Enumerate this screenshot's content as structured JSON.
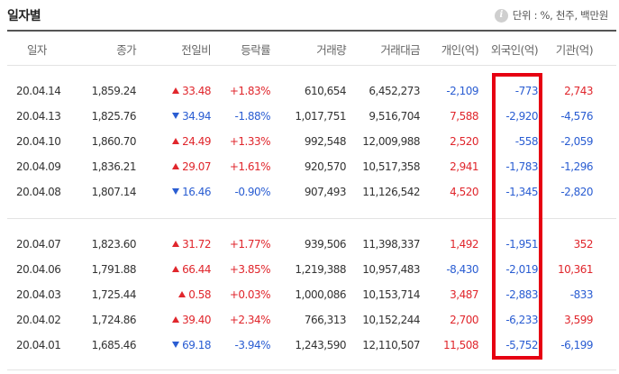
{
  "title": "일자별",
  "unit_text": "단위 : %, 천주, 백만원",
  "columns": [
    "일자",
    "종가",
    "전일비",
    "등락률",
    "거래량",
    "거래대금",
    "개인(억)",
    "외국인(억)",
    "기관(억)"
  ],
  "colors": {
    "up": "#e0262c",
    "down": "#2a5dd2",
    "highlight": "#e60012"
  },
  "rows": [
    {
      "date": "20.04.14",
      "close": "1,859.24",
      "change": "33.48",
      "change_dir": "up",
      "rate": "+1.83%",
      "volume": "610,654",
      "amount": "6,452,273",
      "individual": "-2,109",
      "foreign": "-773",
      "institution": "2,743"
    },
    {
      "date": "20.04.13",
      "close": "1,825.76",
      "change": "34.94",
      "change_dir": "down",
      "rate": "-1.88%",
      "volume": "1,017,751",
      "amount": "9,516,704",
      "individual": "7,588",
      "foreign": "-2,920",
      "institution": "-4,576"
    },
    {
      "date": "20.04.10",
      "close": "1,860.70",
      "change": "24.49",
      "change_dir": "up",
      "rate": "+1.33%",
      "volume": "992,548",
      "amount": "12,009,988",
      "individual": "2,520",
      "foreign": "-558",
      "institution": "-2,059"
    },
    {
      "date": "20.04.09",
      "close": "1,836.21",
      "change": "29.07",
      "change_dir": "up",
      "rate": "+1.61%",
      "volume": "920,570",
      "amount": "10,517,358",
      "individual": "2,941",
      "foreign": "-1,783",
      "institution": "-1,296"
    },
    {
      "date": "20.04.08",
      "close": "1,807.14",
      "change": "16.46",
      "change_dir": "down",
      "rate": "-0.90%",
      "volume": "907,493",
      "amount": "11,126,542",
      "individual": "4,520",
      "foreign": "-1,345",
      "institution": "-2,820"
    },
    {
      "date": "20.04.07",
      "close": "1,823.60",
      "change": "31.72",
      "change_dir": "up",
      "rate": "+1.77%",
      "volume": "939,506",
      "amount": "11,398,337",
      "individual": "1,492",
      "foreign": "-1,951",
      "institution": "352"
    },
    {
      "date": "20.04.06",
      "close": "1,791.88",
      "change": "66.44",
      "change_dir": "up",
      "rate": "+3.85%",
      "volume": "1,219,388",
      "amount": "10,957,483",
      "individual": "-8,430",
      "foreign": "-2,019",
      "institution": "10,361"
    },
    {
      "date": "20.04.03",
      "close": "1,725.44",
      "change": "0.58",
      "change_dir": "up",
      "rate": "+0.03%",
      "volume": "1,000,086",
      "amount": "10,153,714",
      "individual": "3,487",
      "foreign": "-2,883",
      "institution": "-833"
    },
    {
      "date": "20.04.02",
      "close": "1,724.86",
      "change": "39.40",
      "change_dir": "up",
      "rate": "+2.34%",
      "volume": "766,313",
      "amount": "10,152,244",
      "individual": "2,700",
      "foreign": "-6,233",
      "institution": "3,599"
    },
    {
      "date": "20.04.01",
      "close": "1,685.46",
      "change": "69.18",
      "change_dir": "down",
      "rate": "-3.94%",
      "volume": "1,243,590",
      "amount": "12,110,507",
      "individual": "11,508",
      "foreign": "-5,752",
      "institution": "-6,199"
    }
  ]
}
